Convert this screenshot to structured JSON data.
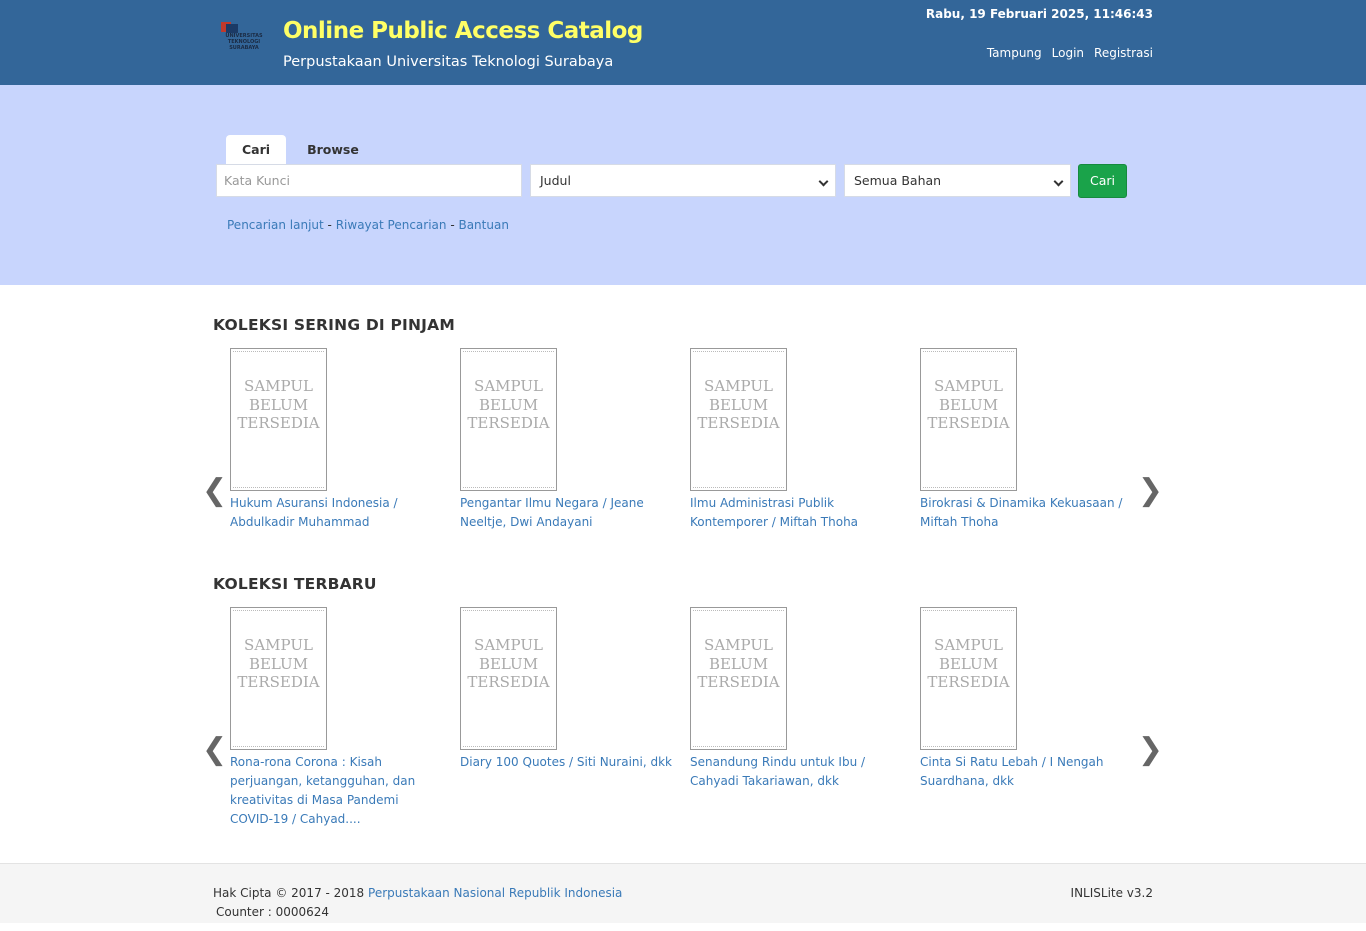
{
  "header": {
    "logo_text": "UNIVERSITAS TEKNOLOGI SURABAYA",
    "title": "Online Public Access Catalog",
    "subtitle": "Perpustakaan Universitas Teknologi Surabaya",
    "datetime": "Rabu, 19 Februari 2025, 11:46:43",
    "nav": [
      "Tampung",
      "Login",
      "Registrasi"
    ]
  },
  "search": {
    "tabs": [
      "Cari",
      "Browse"
    ],
    "keyword_placeholder": "Kata Kunci",
    "field_select": "Judul",
    "material_select": "Semua Bahan",
    "button": "Cari",
    "links": [
      "Pencarian lanjut",
      "Riwayat Pencarian",
      "Bantuan"
    ],
    "separator": " - "
  },
  "cover_placeholder": [
    "SAMPUL",
    "BELUM",
    "TERSEDIA"
  ],
  "popular": {
    "title": "KOLEKSI SERING DI PINJAM",
    "books": [
      "Hukum Asuransi Indonesia / Abdulkadir Muhammad",
      "Pengantar Ilmu Negara / Jeane Neeltje, Dwi Andayani",
      "Ilmu Administrasi Publik Kontemporer / Miftah Thoha",
      "Birokrasi & Dinamika Kekuasaan / Miftah Thoha"
    ]
  },
  "newest": {
    "title": "KOLEKSI TERBARU",
    "books": [
      "Rona-rona Corona : Kisah perjuangan, ketangguhan, dan kreativitas di Masa Pandemi COVID-19 / Cahyad....",
      "Diary 100 Quotes / Siti Nuraini, dkk",
      "Senandung Rindu untuk Ibu / Cahyadi Takariawan, dkk",
      "Cinta Si Ratu Lebah / I Nengah Suardhana, dkk"
    ]
  },
  "arrows": {
    "prev": "❮",
    "next": "❯"
  },
  "footer": {
    "copyright_prefix": "Hak Cipta © 2017 - 2018 ",
    "copyright_link": "Perpustakaan Nasional Republik Indonesia",
    "counter": "Counter : 0000624",
    "version": "INLISLite v3.2"
  }
}
